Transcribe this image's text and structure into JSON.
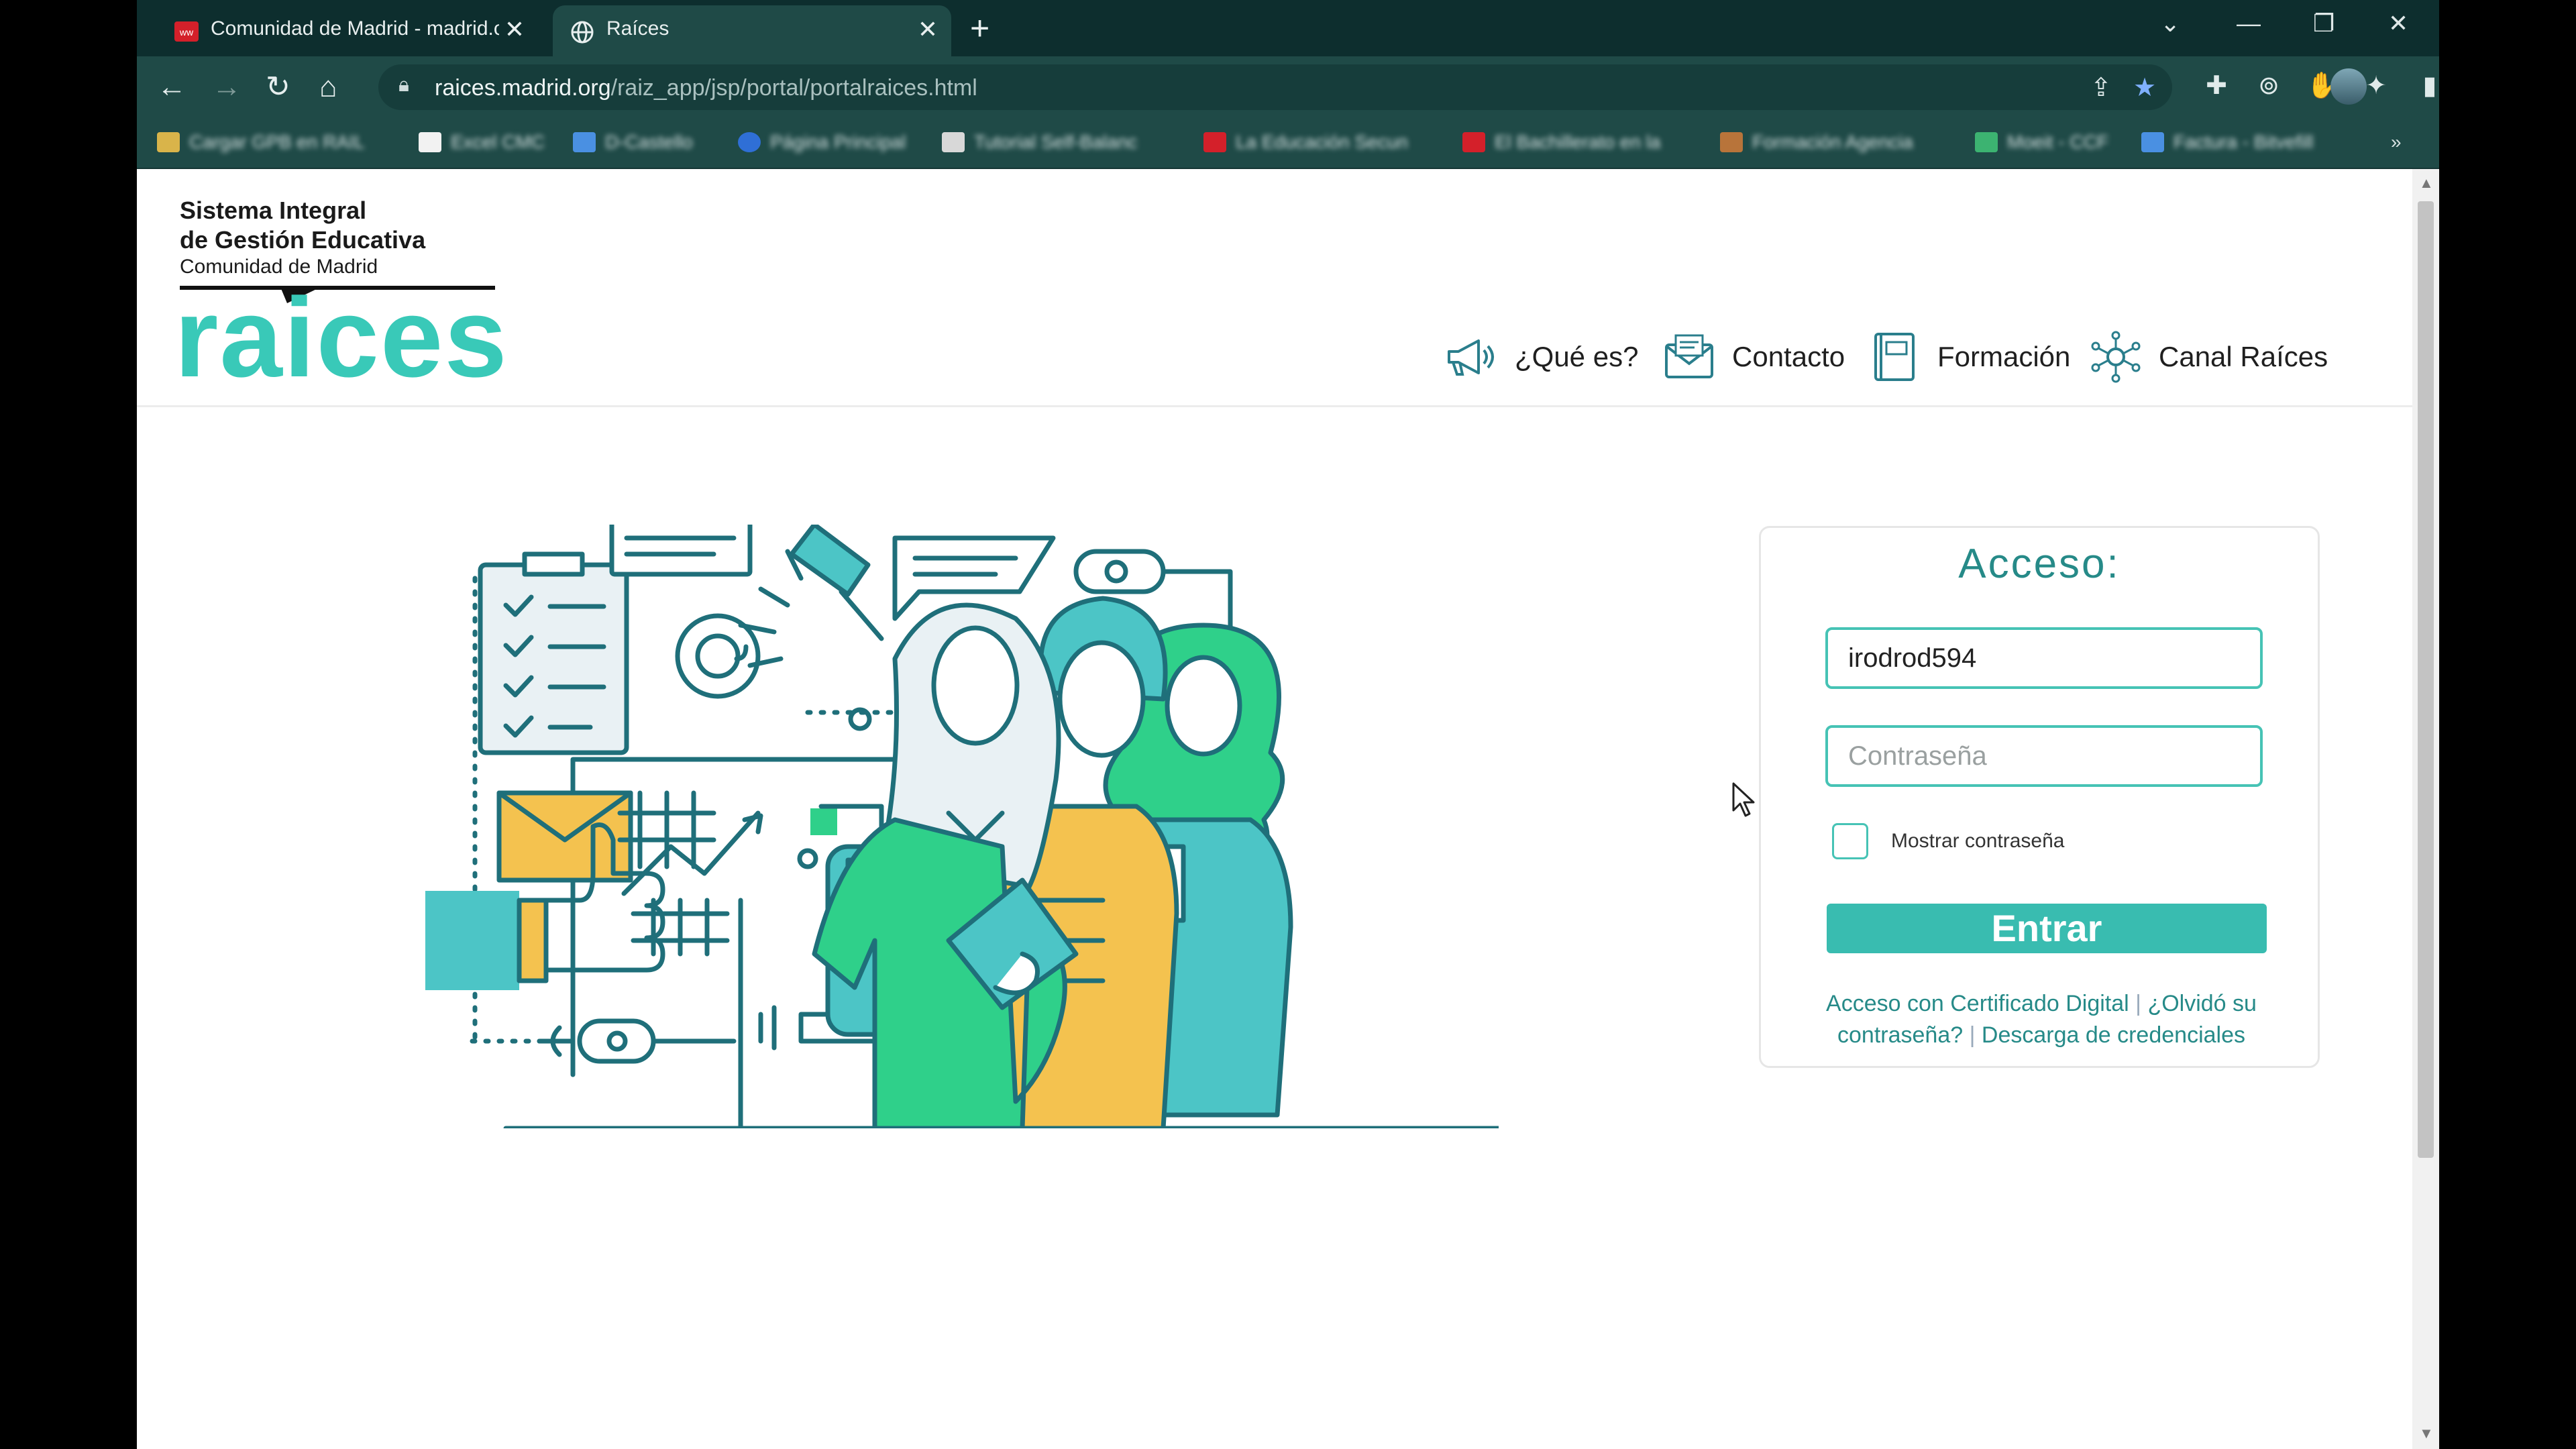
{
  "browser": {
    "tabs": [
      {
        "title": "Comunidad de Madrid - madrid.org",
        "active": false
      },
      {
        "title": "Raíces",
        "active": true
      }
    ],
    "new_tab_label": "+",
    "url_host": "raices.madrid.org",
    "url_path": "/raiz_app/jsp/portal/portalraices.html",
    "window_controls": {
      "dropdown": "⌄",
      "minimize": "—",
      "restore": "❐",
      "close": "✕"
    }
  },
  "header": {
    "brand_line1": "Sistema Integral",
    "brand_line2": "de Gestión Educativa",
    "brand_line3": "Comunidad de Madrid",
    "logo_text": "raices",
    "nav": [
      {
        "label": "¿Qué es?",
        "icon": "megaphone-icon"
      },
      {
        "label": "Contacto",
        "icon": "mail-icon"
      },
      {
        "label": "Formación",
        "icon": "book-icon"
      },
      {
        "label": "Canal Raíces",
        "icon": "network-icon"
      }
    ]
  },
  "login": {
    "title": "Acceso:",
    "username_value": "irodrod594",
    "password_placeholder": "Contraseña",
    "show_password_label": "Mostrar contraseña",
    "submit_label": "Entrar",
    "link_certificate": "Acceso con Certificado Digital",
    "link_forgot": "¿Olvidó su contraseña?",
    "link_credentials": "Descarga de credenciales",
    "separator": "|"
  },
  "colors": {
    "accent": "#39c9b8",
    "link": "#268a88",
    "browser_frame": "#1f4a47",
    "tabstrip": "#0d2e2e"
  }
}
